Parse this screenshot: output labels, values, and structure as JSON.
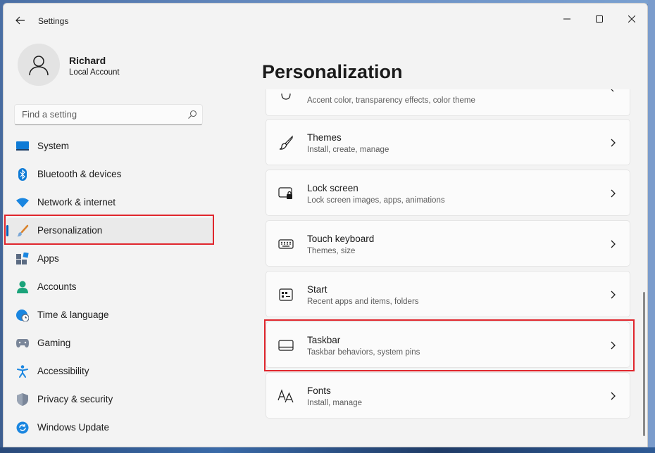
{
  "window": {
    "title": "Settings",
    "accent_color": "#005fb8",
    "highlight_color": "#e0262d"
  },
  "user": {
    "name": "Richard",
    "account_type": "Local Account"
  },
  "search": {
    "placeholder": "Find a setting"
  },
  "sidebar": {
    "items": [
      {
        "label": "System",
        "icon": "system-icon"
      },
      {
        "label": "Bluetooth & devices",
        "icon": "bluetooth-icon"
      },
      {
        "label": "Network & internet",
        "icon": "wifi-icon"
      },
      {
        "label": "Personalization",
        "icon": "brush-icon",
        "selected": true
      },
      {
        "label": "Apps",
        "icon": "apps-icon"
      },
      {
        "label": "Accounts",
        "icon": "person-icon"
      },
      {
        "label": "Time & language",
        "icon": "globe-clock-icon"
      },
      {
        "label": "Gaming",
        "icon": "gamepad-icon"
      },
      {
        "label": "Accessibility",
        "icon": "accessibility-icon"
      },
      {
        "label": "Privacy & security",
        "icon": "shield-icon"
      },
      {
        "label": "Windows Update",
        "icon": "update-icon"
      }
    ]
  },
  "main": {
    "title": "Personalization",
    "cards": [
      {
        "title": "",
        "desc": "Accent color, transparency effects, color theme",
        "icon": "palette-icon"
      },
      {
        "title": "Themes",
        "desc": "Install, create, manage",
        "icon": "brush-outline-icon"
      },
      {
        "title": "Lock screen",
        "desc": "Lock screen images, apps, animations",
        "icon": "lock-screen-icon"
      },
      {
        "title": "Touch keyboard",
        "desc": "Themes, size",
        "icon": "keyboard-icon"
      },
      {
        "title": "Start",
        "desc": "Recent apps and items, folders",
        "icon": "start-icon"
      },
      {
        "title": "Taskbar",
        "desc": "Taskbar behaviors, system pins",
        "icon": "taskbar-icon",
        "highlighted": true
      },
      {
        "title": "Fonts",
        "desc": "Install, manage",
        "icon": "fonts-icon"
      }
    ]
  }
}
